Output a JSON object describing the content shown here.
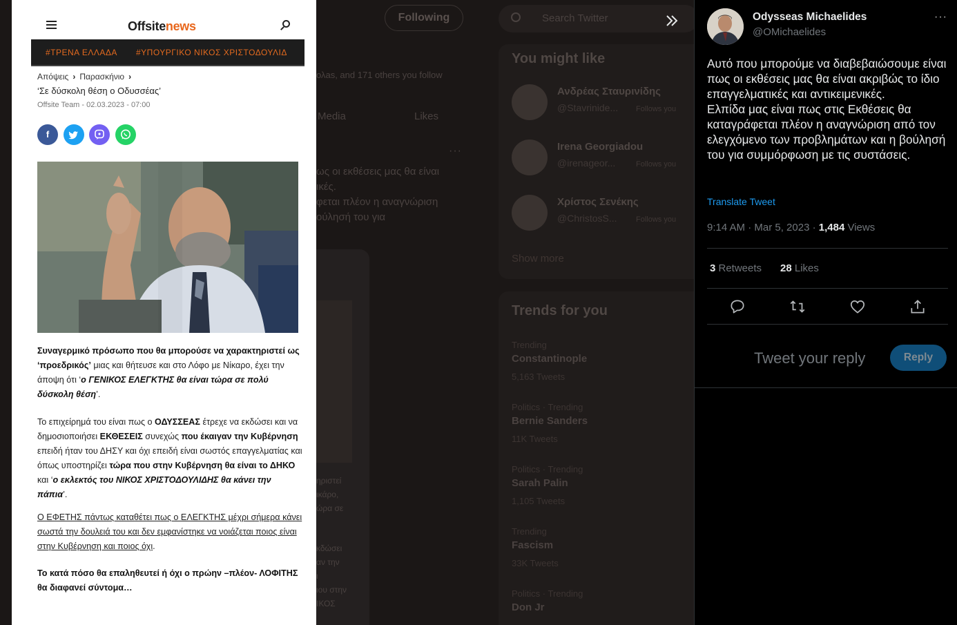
{
  "background": {
    "following_label": "Following",
    "search_placeholder": "Search Twitter",
    "followers_note": "ολas, and 171 others you follow",
    "tabs": [
      "Media",
      "Likes"
    ],
    "more": "···",
    "tweet_lines": [
      "ως οι εκθέσεις μας θα είναι",
      "ικές.",
      "φεται πλέον η αναγνώριση",
      "ούλησή του για"
    ],
    "card_lines": [
      "ηριστεί",
      "ικάρο,",
      "ώρα σε",
      "κδώσει",
      "αν την",
      "ι",
      "ιου στην",
      "ΙΚΟΣ"
    ],
    "might_like_title": "You might like",
    "suggested": [
      {
        "name": "Ανδρέας Σταυρινίδης",
        "handle": "@Stavrinide...",
        "follows": "Follows you"
      },
      {
        "name": "Irena Georgiadou",
        "handle": "@irenageor...",
        "follows": "Follows you"
      },
      {
        "name": "Χρίστος Σενέκης",
        "handle": "@ChristosS...",
        "follows": "Follows you"
      }
    ],
    "show_more": "Show more",
    "trends_title": "Trends for you",
    "trends": [
      {
        "meta": "Trending",
        "name": "Constantinople",
        "count": "5,163 Tweets"
      },
      {
        "meta": "Politics · Trending",
        "name": "Bernie Sanders",
        "count": "11K Tweets"
      },
      {
        "meta": "Politics · Trending",
        "name": "Sarah Palin",
        "count": "1,105 Tweets"
      },
      {
        "meta": "Trending",
        "name": "Fascism",
        "count": "33K Tweets"
      },
      {
        "meta": "Politics · Trending",
        "name": "Don Jr",
        "count": ""
      }
    ]
  },
  "article": {
    "logo_part1": "Offsite",
    "logo_part2": "news",
    "tags": [
      "#ΤΡΕΝΑ ΕΛΛΑΔΑ",
      "#ΥΠΟΥΡΓΙΚΟ ΝΙΚΟΣ ΧΡΙΣΤΟΔΟΥΛΙΔ"
    ],
    "breadcrumb": [
      "Απόψεις",
      "Παρασκήνιο"
    ],
    "title": "‘Σε δύσκολη θέση ο Οδυσσέας’",
    "meta": "Offsite Team - 02.03.2023 - 07:00",
    "share_icons": [
      "facebook-icon",
      "twitter-icon",
      "viber-icon",
      "whatsapp-icon"
    ],
    "paragraphs": {
      "p1_a": "Συναγερμικό πρόσωπο που θα μπορούσε να χαρακτηριστεί ως ‘προεδρικός’",
      "p1_b": " μιας και θήτευσε και στο Λόφο με Νίκαρο, έχει την άποψη ότι ‘",
      "p1_c": "ο ΓΕΝΙΚΟΣ ΕΛΕΓΚΤΗΣ θα είναι τώρα σε πολύ δύσκολη θέση",
      "p1_d": "’.",
      "p2_a": "Το επιχείρημά του είναι πως ο ",
      "p2_b": "ΟΔΥΣΣΕΑΣ",
      "p2_c": " έτρεχε να εκδώσει και να δημοσιοποιήσει ",
      "p2_d": "ΕΚΘΕΣΕΙΣ",
      "p2_e": " συνεχώς ",
      "p2_f": "που έκαιγαν την Κυβέρνηση",
      "p2_g": " επειδή ήταν του ΔΗΣΥ και όχι επειδή είναι σωστός επαγγελματίας και όπως υποστηρίζει ",
      "p2_h": "τώρα που στην Κυβέρνηση θα είναι το ΔΗΚΟ",
      "p2_i": " και ‘",
      "p2_j": "ο εκλεκτός του ΝΙΚΟΣ ΧΡΙΣΤΟΔΟΥΛΙΔΗΣ θα κάνει την πάπια",
      "p2_k": "’.",
      "p3": "Ο ΕΦΕΤΗΣ πάντως καταθέτει πως ο ΕΛΕΓΚΤΗΣ μέχρι σήμερα κάνει σωστά την δουλειά του και δεν εμφανίστηκε να νοιάζεται ποιος είναι στην Κυβέρνηση και ποιος όχι",
      "p3_end": ".",
      "p4": "Το κατά πόσο θα επαληθευτεί ή όχι ο πρώην –πλέον- ΛΟΦΙΤΗΣ θα διαφανεί σύντομα…"
    }
  },
  "tweet": {
    "name": "Odysseas Michaelides",
    "handle": "@OMichaelides",
    "text": "Αυτό που μπορούμε να διαβεβαιώσουμε είναι πως οι εκθέσεις μας θα είναι ακριβώς το ίδιο επαγγελματικές και αντικειμενικές.\nΕλπίδα μας είναι πως στις Εκθέσεις θα καταγράφεται πλέον η αναγνώριση από τον ελεγχόμενο των προβλημάτων και η βούλησή του για συμμόρφωση με τις συστάσεις.",
    "translate": "Translate Tweet",
    "time": "9:14 AM · Mar 5, 2023 · ",
    "views_count": "1,484",
    "views_label": " Views",
    "retweets_count": "3",
    "retweets_label": " Retweets",
    "likes_count": "28",
    "likes_label": " Likes",
    "reply_placeholder": "Tweet your reply",
    "reply_button": "Reply",
    "more": "···"
  },
  "colors": {
    "accent": "#1d9bf0",
    "brand_orange": "#e8671c",
    "facebook": "#3b5998",
    "twitter": "#1da1f2",
    "viber": "#7360f2",
    "whatsapp": "#25d366"
  }
}
